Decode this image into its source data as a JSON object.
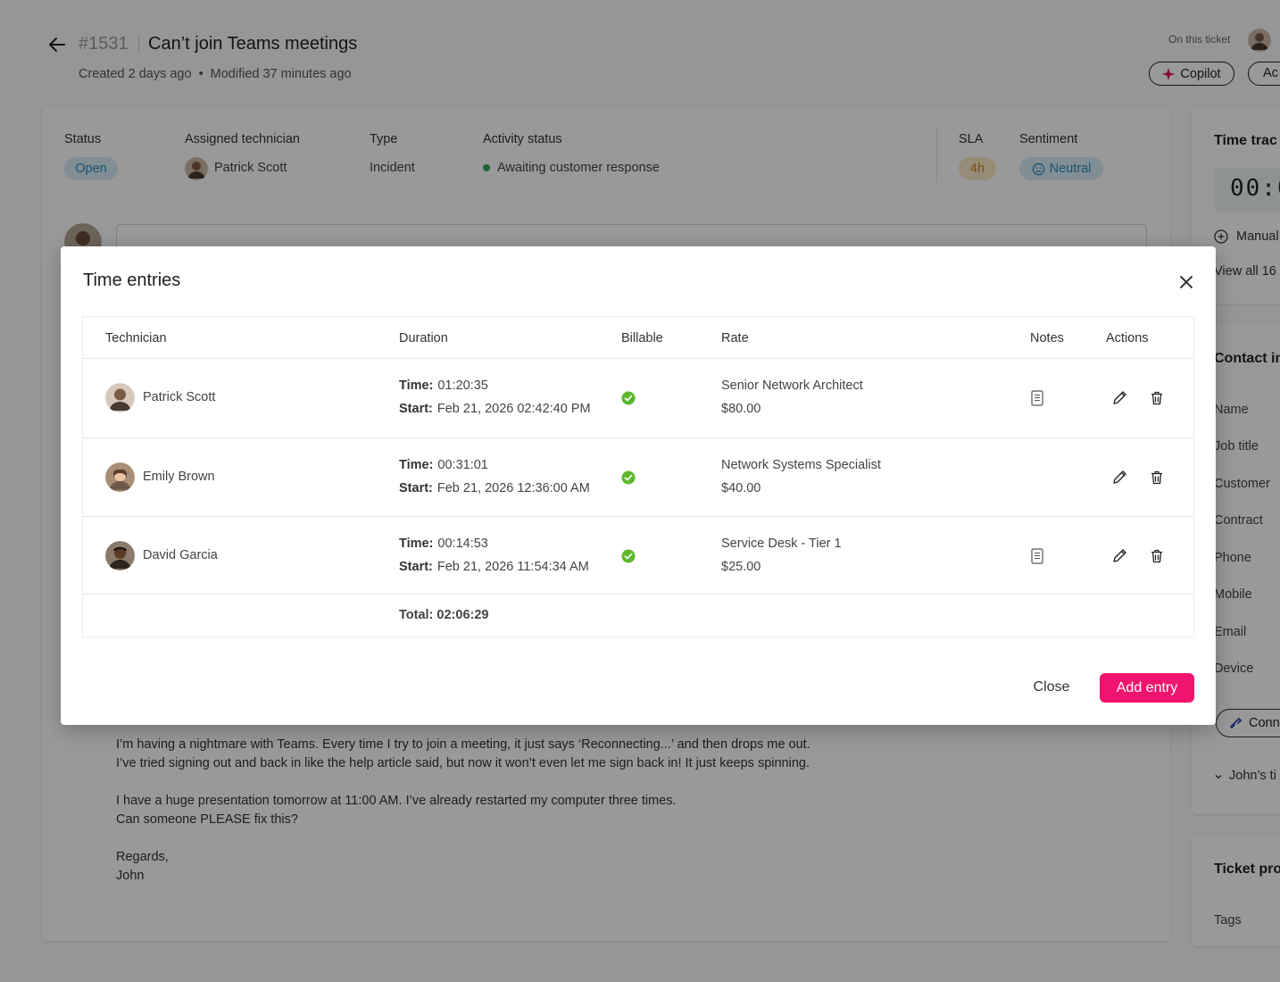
{
  "ticket": {
    "number": "#1531",
    "title": "Can’t join Teams meetings",
    "created": "Created 2 days ago",
    "modified": "Modified 37 minutes ago",
    "on_this_ticket": "On this ticket",
    "copilot_label": "Copilot",
    "actions_label": "Ac"
  },
  "summary": {
    "status_label": "Status",
    "status_value": "Open",
    "tech_label": "Assigned technician",
    "tech_value": "Patrick Scott",
    "type_label": "Type",
    "type_value": "Incident",
    "activity_label": "Activity status",
    "activity_value": "Awaiting customer response",
    "sla_label": "SLA",
    "sla_value": "4h",
    "sentiment_label": "Sentiment",
    "sentiment_value": "Neutral"
  },
  "message": {
    "line1": "I’m having a nightmare with Teams. Every time I try to join a meeting, it just says ‘Reconnecting...’ and then drops me out.",
    "line2": "I’ve tried signing out and back in like the help article said, but now it won’t even let me sign back in! It just keeps spinning.",
    "line3": "I have a huge presentation tomorrow at 11:00 AM. I’ve already restarted my computer three times.",
    "line4": "Can someone PLEASE fix this?",
    "line5": "Regards,",
    "line6": "John"
  },
  "sidebar": {
    "time_title": "Time trac",
    "timer": "00:0",
    "manual": "Manual",
    "view_all": "View all 16",
    "contact_title": "Contact in",
    "contact_fields": [
      "Name",
      "Job title",
      "Customer",
      "Contract",
      "Phone",
      "Mobile",
      "Email",
      "Device"
    ],
    "connect": "Conn",
    "johns": "John’s ti",
    "ticket_props": "Ticket pro",
    "tags": "Tags"
  },
  "modal": {
    "title": "Time entries",
    "columns": {
      "technician": "Technician",
      "duration": "Duration",
      "billable": "Billable",
      "rate": "Rate",
      "notes": "Notes",
      "actions": "Actions"
    },
    "time_prefix": "Time:",
    "start_prefix": "Start:",
    "entries": [
      {
        "technician": "Patrick Scott",
        "time": "01:20:35",
        "start": "Feb 21, 2026 02:42:40 PM",
        "billable": true,
        "rate_name": "Senior Network Architect",
        "rate_amount": "$80.00",
        "has_notes": true
      },
      {
        "technician": "Emily Brown",
        "time": "00:31:01",
        "start": "Feb 21, 2026 12:36:00 AM",
        "billable": true,
        "rate_name": "Network Systems Specialist",
        "rate_amount": "$40.00",
        "has_notes": false
      },
      {
        "technician": "David Garcia",
        "time": "00:14:53",
        "start": "Feb 21, 2026 11:54:34 AM",
        "billable": true,
        "rate_name": "Service Desk - Tier 1",
        "rate_amount": "$25.00",
        "has_notes": true
      }
    ],
    "total": "Total: 02:06:29",
    "close_label": "Close",
    "add_label": "Add entry"
  },
  "colors": {
    "accent": "#f0146e",
    "billable_check": "#5cb82e",
    "status_open": "#2c8dc0",
    "sla": "#c98a1a"
  }
}
